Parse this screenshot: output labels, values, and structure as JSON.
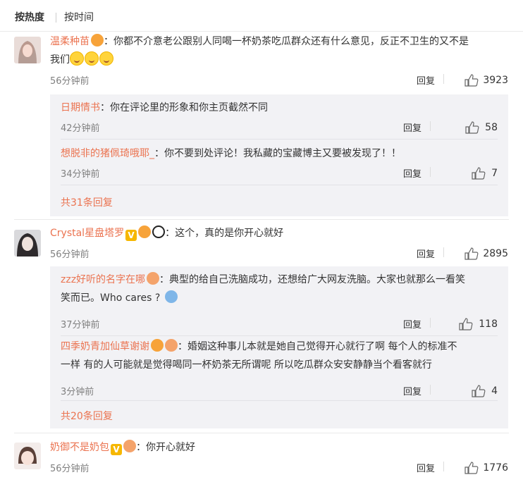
{
  "tabs": {
    "hot": "按热度",
    "time": "按时间"
  },
  "comments": [
    {
      "user": "温柔种苗",
      "text": "：你都不介意老公跟别人同喝一杯奶茶吃瓜群众还有什么意见，反正不卫生的又不是",
      "text2": "我们",
      "time": "56分钟前",
      "reply": "回复",
      "likes": "3923",
      "subs": [
        {
          "user": "日期情书",
          "text": "：你在评论里的形象和你主页截然不同",
          "time": "42分钟前",
          "reply": "回复",
          "likes": "58"
        },
        {
          "user": "想脱非的猪佩琦哦耶_",
          "text": "：你不要到处评论！我私藏的宝藏博主又要被发现了！！",
          "time": "34分钟前",
          "reply": "回复",
          "likes": "7"
        }
      ],
      "more": "共31条回复"
    },
    {
      "user": "Crystal星盘塔罗",
      "text": "：这个，真的是你开心就好",
      "time": "56分钟前",
      "reply": "回复",
      "likes": "2895",
      "subs": [
        {
          "user": "zzz好听的名字在哪",
          "text": "：典型的给自己洗脑成功，还想给广大网友洗脑。大家也就那么一看笑",
          "text2": "笑而已。Who cares ?",
          "time": "37分钟前",
          "reply": "回复",
          "likes": "118"
        },
        {
          "user": "四季奶青加仙草谢谢",
          "text": "：婚姻这种事儿本就是她自己觉得开心就行了啊 每个人的标准不",
          "text2": "一样 有的人可能就是觉得喝同一杯奶茶无所谓呢 所以吃瓜群众安安静静当个看客就行",
          "time": "3分钟前",
          "reply": "回复",
          "likes": "4"
        }
      ],
      "more": "共20条回复"
    },
    {
      "user": "奶御不是奶包",
      "text": "：你开心就好",
      "time": "56分钟前",
      "reply": "回复",
      "likes": "1776"
    }
  ],
  "icons": {
    "like": "thumbs-up-icon",
    "vip": "vip-badge-icon",
    "emoji": "emoji-icon"
  },
  "colors": {
    "username": "#eb7350",
    "meta": "#808080",
    "subbox": "#f2f2f5"
  }
}
